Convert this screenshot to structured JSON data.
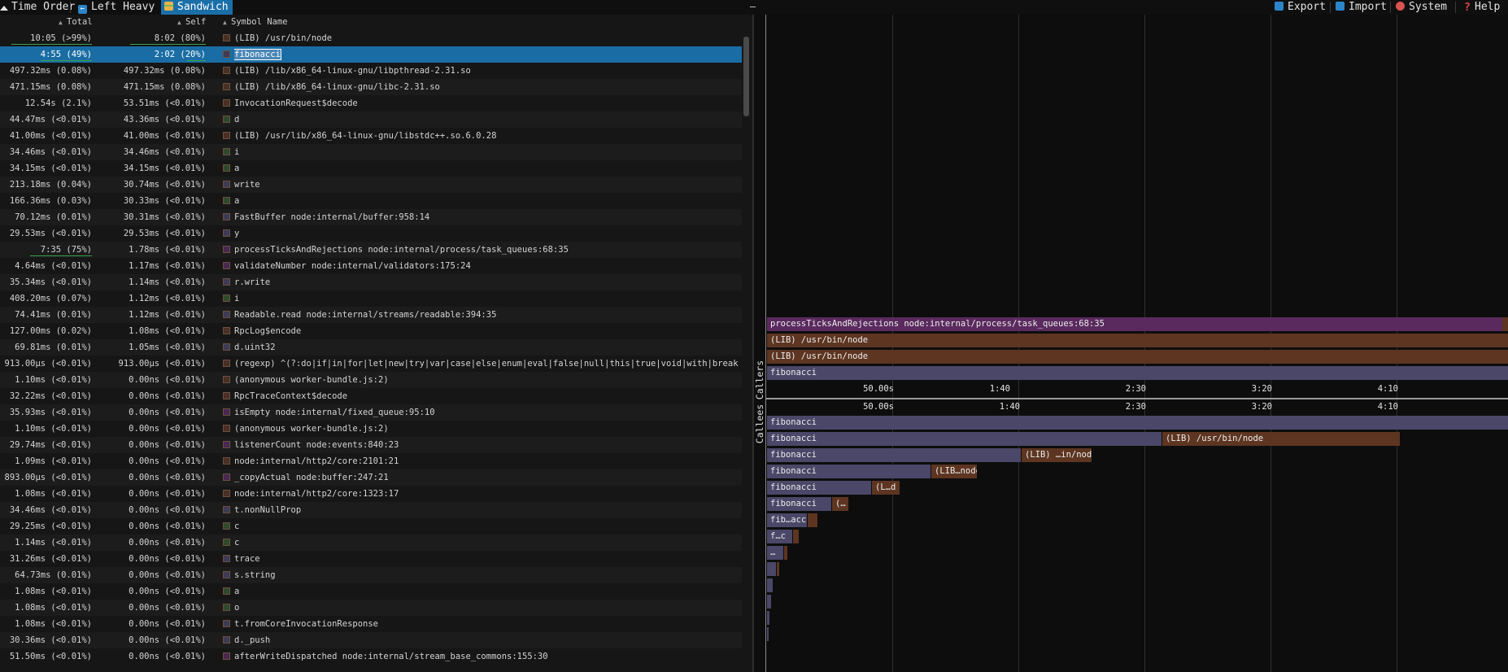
{
  "tabs": [
    {
      "label": "Time Order",
      "active": false,
      "icon": "timeline-icon"
    },
    {
      "label": "Left Heavy",
      "active": false,
      "icon": "left-arrow-icon"
    },
    {
      "label": "Sandwich",
      "active": true,
      "icon": "sandwich-icon"
    }
  ],
  "actions": {
    "export_label": "Export",
    "import_label": "Import",
    "system_label": "System",
    "help_label": "Help"
  },
  "columns": {
    "total": "Total",
    "self": "Self",
    "symbol": "Symbol Name"
  },
  "rows": [
    {
      "total": "10:05 (>99%)",
      "self": "8:02 (80%)",
      "name": "(LIB) /usr/bin/node",
      "color": "#4a2f24"
    },
    {
      "total": "4:55 (49%)",
      "self": "2:02 (20%)",
      "name": "fibonacci",
      "color": "#3d3b56",
      "selected": true
    },
    {
      "total": "497.32ms (0.08%)",
      "self": "497.32ms (0.08%)",
      "name": "(LIB) /lib/x86_64-linux-gnu/libpthread-2.31.so",
      "color": "#4a2f24"
    },
    {
      "total": "471.15ms (0.08%)",
      "self": "471.15ms (0.08%)",
      "name": "(LIB) /lib/x86_64-linux-gnu/libc-2.31.so",
      "color": "#4a2f24"
    },
    {
      "total": "12.54s (2.1%)",
      "self": "53.51ms (<0.01%)",
      "name": "InvocationRequest$decode",
      "color": "#4a2f24"
    },
    {
      "total": "44.47ms (<0.01%)",
      "self": "43.36ms (<0.01%)",
      "name": "d",
      "color": "#2f4a2a"
    },
    {
      "total": "41.00ms (<0.01%)",
      "self": "41.00ms (<0.01%)",
      "name": "(LIB) /usr/lib/x86_64-linux-gnu/libstdc++.so.6.0.28",
      "color": "#4a2f24"
    },
    {
      "total": "34.46ms (<0.01%)",
      "self": "34.46ms (<0.01%)",
      "name": "i",
      "color": "#2f4a2a"
    },
    {
      "total": "34.15ms (<0.01%)",
      "self": "34.15ms (<0.01%)",
      "name": "a",
      "color": "#2f4a2a"
    },
    {
      "total": "213.18ms (0.04%)",
      "self": "30.74ms (<0.01%)",
      "name": "write",
      "color": "#3d3b56"
    },
    {
      "total": "166.36ms (0.03%)",
      "self": "30.33ms (<0.01%)",
      "name": "a",
      "color": "#2f4a2a"
    },
    {
      "total": "70.12ms (0.01%)",
      "self": "30.31ms (<0.01%)",
      "name": "FastBuffer node:internal/buffer:958:14",
      "color": "#3d3b56"
    },
    {
      "total": "29.53ms (<0.01%)",
      "self": "29.53ms (<0.01%)",
      "name": "y",
      "color": "#3d3b56"
    },
    {
      "total": "7:35 (75%)",
      "self": "1.78ms (<0.01%)",
      "name": "processTicksAndRejections node:internal/process/task_queues:68:35",
      "color": "#4a2750"
    },
    {
      "total": "4.64ms (<0.01%)",
      "self": "1.17ms (<0.01%)",
      "name": "validateNumber node:internal/validators:175:24",
      "color": "#4a2750"
    },
    {
      "total": "35.34ms (<0.01%)",
      "self": "1.14ms (<0.01%)",
      "name": "r.write",
      "color": "#3d3b56"
    },
    {
      "total": "408.20ms (0.07%)",
      "self": "1.12ms (<0.01%)",
      "name": "i",
      "color": "#2f4a2a"
    },
    {
      "total": "74.41ms (0.01%)",
      "self": "1.12ms (<0.01%)",
      "name": "Readable.read node:internal/streams/readable:394:35",
      "color": "#3d3b56"
    },
    {
      "total": "127.00ms (0.02%)",
      "self": "1.08ms (<0.01%)",
      "name": "RpcLog$encode",
      "color": "#4a2f24"
    },
    {
      "total": "69.81ms (0.01%)",
      "self": "1.05ms (<0.01%)",
      "name": "d.uint32",
      "color": "#3d3b56"
    },
    {
      "total": "913.00µs (<0.01%)",
      "self": "913.00µs (<0.01%)",
      "name": "(regexp) ^(?:do|if|in|for|let|new|try|var|case|else|enum|eval|false|null|this|true|void|with|break|cat…",
      "color": "#4a2f24"
    },
    {
      "total": "1.10ms (<0.01%)",
      "self": "0.00ns (<0.01%)",
      "name": "(anonymous worker-bundle.js:2)",
      "color": "#4a2f24"
    },
    {
      "total": "32.22ms (<0.01%)",
      "self": "0.00ns (<0.01%)",
      "name": "RpcTraceContext$decode",
      "color": "#4a2f24"
    },
    {
      "total": "35.93ms (<0.01%)",
      "self": "0.00ns (<0.01%)",
      "name": "isEmpty node:internal/fixed_queue:95:10",
      "color": "#4a2750"
    },
    {
      "total": "1.10ms (<0.01%)",
      "self": "0.00ns (<0.01%)",
      "name": "(anonymous worker-bundle.js:2)",
      "color": "#4a2f24"
    },
    {
      "total": "29.74ms (<0.01%)",
      "self": "0.00ns (<0.01%)",
      "name": "listenerCount node:events:840:23",
      "color": "#4a2750"
    },
    {
      "total": "1.09ms (<0.01%)",
      "self": "0.00ns (<0.01%)",
      "name": " node:internal/http2/core:2101:21",
      "color": "#4a2f24"
    },
    {
      "total": "893.00µs (<0.01%)",
      "self": "0.00ns (<0.01%)",
      "name": "_copyActual node:buffer:247:21",
      "color": "#4a2750"
    },
    {
      "total": "1.08ms (<0.01%)",
      "self": "0.00ns (<0.01%)",
      "name": " node:internal/http2/core:1323:17",
      "color": "#4a2f24"
    },
    {
      "total": "34.46ms (<0.01%)",
      "self": "0.00ns (<0.01%)",
      "name": "t.nonNullProp",
      "color": "#3d3b56"
    },
    {
      "total": "29.25ms (<0.01%)",
      "self": "0.00ns (<0.01%)",
      "name": "c",
      "color": "#2f4a2a"
    },
    {
      "total": "1.14ms (<0.01%)",
      "self": "0.00ns (<0.01%)",
      "name": "c",
      "color": "#2f4a2a"
    },
    {
      "total": "31.26ms (<0.01%)",
      "self": "0.00ns (<0.01%)",
      "name": "trace",
      "color": "#3d3b56"
    },
    {
      "total": "64.73ms (0.01%)",
      "self": "0.00ns (<0.01%)",
      "name": "s.string",
      "color": "#3d3b56"
    },
    {
      "total": "1.08ms (<0.01%)",
      "self": "0.00ns (<0.01%)",
      "name": "a",
      "color": "#2f4a2a"
    },
    {
      "total": "1.08ms (<0.01%)",
      "self": "0.00ns (<0.01%)",
      "name": "o",
      "color": "#2f4a2a"
    },
    {
      "total": "1.08ms (<0.01%)",
      "self": "0.00ns (<0.01%)",
      "name": "t.fromCoreInvocationResponse",
      "color": "#3d3b56"
    },
    {
      "total": "30.36ms (<0.01%)",
      "self": "0.00ns (<0.01%)",
      "name": "d._push",
      "color": "#3d3b56"
    },
    {
      "total": "51.50ms (<0.01%)",
      "self": "0.00ns (<0.01%)",
      "name": "afterWriteDispatched node:internal/stream_base_commons:155:30",
      "color": "#4a2750"
    }
  ],
  "flame": {
    "callers_label": "Callers",
    "callees_label": "Callees",
    "ticks": [
      "50.00s",
      "1:40",
      "2:30",
      "3:20",
      "4:10"
    ],
    "callers_frames": {
      "processTicks": "processTicksAndRejections node:internal/process/task_queues:68:35",
      "node1": "(LIB) /usr/bin/node",
      "node2": "(LIB) /usr/bin/node",
      "fib": "fibonacci"
    },
    "callees_frames": {
      "fib0": "fibonacci",
      "fib1": "fibonacci",
      "lib1": "(LIB) /usr/bin/node",
      "fib2": "fibonacci",
      "lib2": "(LIB) …in/nod",
      "fib3": "fibonacci",
      "lib3": "(LIB…node",
      "fib4": "fibonacci",
      "lib4": "(L…d",
      "fib5": "fibonacci",
      "lib5": "(…",
      "fib6": "fib…acc",
      "fib7": "f…c",
      "fib8": "…"
    },
    "colors": {
      "purple": "#5a2a5e",
      "brown": "#5d3521",
      "slate": "#4a4768"
    }
  }
}
